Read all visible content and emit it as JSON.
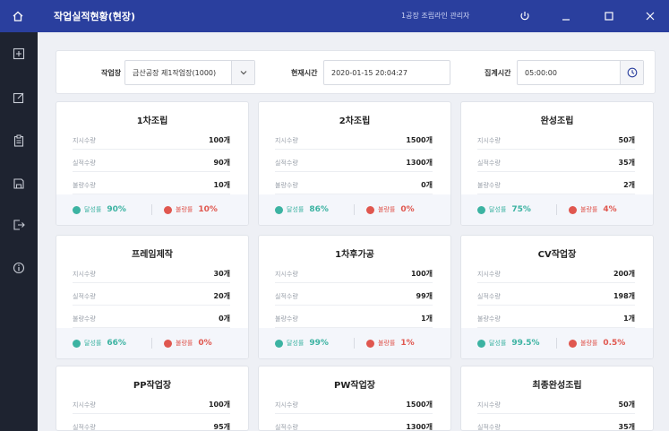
{
  "window": {
    "title": "작업실적현황(현장)",
    "user": "1공장 조립라인 관리자"
  },
  "filter": {
    "workplace_label": "작업장",
    "workplace_value": "금산공장 제1작업장(1000)",
    "current_time_label": "현재시간",
    "current_time_value": "2020-01-15 20:04:27",
    "count_time_label": "집계시간",
    "count_time_value": "05:00:00"
  },
  "labels": {
    "instruct": "지시수량",
    "actual": "실적수량",
    "defect": "불량수량",
    "achieve": "달성률",
    "defect_rate": "불량률"
  },
  "colors": {
    "accent": "#2a3f9e",
    "sidebar": "#1e2330",
    "achieve": "#3cb3a2",
    "defect": "#e0574f"
  },
  "cards": [
    {
      "title": "1차조립",
      "instruct": "100개",
      "actual": "90개",
      "defect": "10개",
      "achieve": "90%",
      "defect_rate": "10%"
    },
    {
      "title": "2차조립",
      "instruct": "1500개",
      "actual": "1300개",
      "defect": "0개",
      "achieve": "86%",
      "defect_rate": "0%"
    },
    {
      "title": "완성조립",
      "instruct": "50개",
      "actual": "35개",
      "defect": "2개",
      "achieve": "75%",
      "defect_rate": "4%"
    },
    {
      "title": "프레임제작",
      "instruct": "30개",
      "actual": "20개",
      "defect": "0개",
      "achieve": "66%",
      "defect_rate": "0%"
    },
    {
      "title": "1차후가공",
      "instruct": "100개",
      "actual": "99개",
      "defect": "1개",
      "achieve": "99%",
      "defect_rate": "1%"
    },
    {
      "title": "CV작업장",
      "instruct": "200개",
      "actual": "198개",
      "defect": "1개",
      "achieve": "99.5%",
      "defect_rate": "0.5%"
    },
    {
      "title": "PP작업장",
      "instruct": "100개",
      "actual": "95개"
    },
    {
      "title": "PW작업장",
      "instruct": "1500개",
      "actual": "1300개"
    },
    {
      "title": "최종완성조립",
      "instruct": "50개",
      "actual": "35개"
    }
  ]
}
